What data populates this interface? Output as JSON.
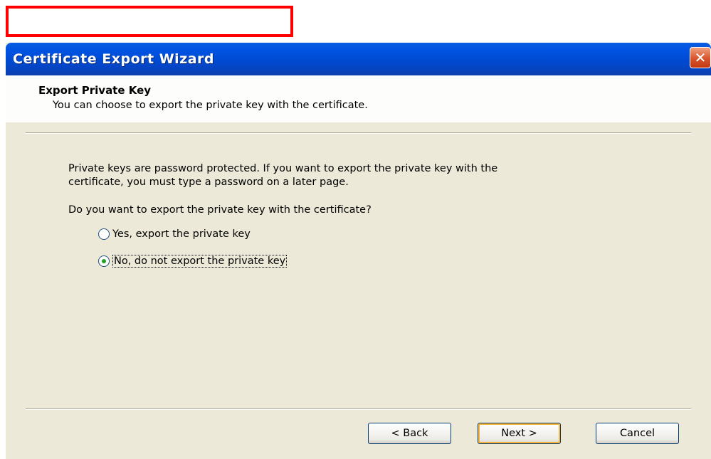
{
  "dialog": {
    "title": "Certificate Export Wizard",
    "close_glyph": "✕"
  },
  "header": {
    "title": "Export Private Key",
    "subtitle": "You can choose to export the private key with the certificate."
  },
  "body": {
    "info_line1": "Private keys are password protected. If you want to export the private key with the",
    "info_line2": "certificate, you must type a password on a later page.",
    "question": "Do you want to export the private key with the certificate?"
  },
  "options": [
    {
      "label": "Yes, export the private key",
      "checked": false
    },
    {
      "label": "No, do not export the private key",
      "checked": true
    }
  ],
  "buttons": {
    "back": "< Back",
    "next": "Next >",
    "cancel": "Cancel"
  },
  "colors": {
    "title_bar": "#0054e3",
    "dialog_bg": "#ece9d8",
    "highlight_border": "#ff0000",
    "close_button": "#d9542c"
  }
}
